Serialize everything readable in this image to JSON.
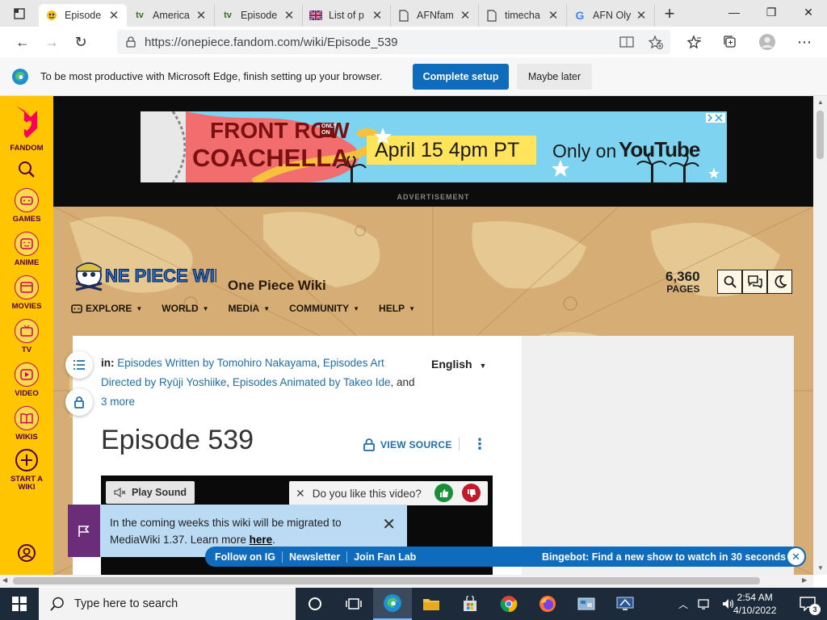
{
  "browser": {
    "tabs": [
      {
        "title": "Episode",
        "icon": "onepiece-favicon",
        "active": true
      },
      {
        "title": "America",
        "icon": "tv-favicon"
      },
      {
        "title": "Episode",
        "icon": "tv-favicon"
      },
      {
        "title": "List of p",
        "icon": "flag-favicon"
      },
      {
        "title": "AFNfam",
        "icon": "page-icon"
      },
      {
        "title": "timecha",
        "icon": "page-icon"
      },
      {
        "title": "AFN Oly",
        "icon": "google-favicon"
      }
    ],
    "new_tab": "+",
    "url": "https://onepiece.fandom.com/wiki/Episode_539"
  },
  "setup_bar": {
    "message": "To be most productive with Microsoft Edge, finish setting up your browser.",
    "complete_label": "Complete setup",
    "later_label": "Maybe later",
    "accent": "#0f6cbd"
  },
  "fandom_rail": {
    "logo_label": "FANDOM",
    "items": [
      {
        "label": "GAMES",
        "icon": "gamepad-icon"
      },
      {
        "label": "ANIME",
        "icon": "anime-face-icon"
      },
      {
        "label": "MOVIES",
        "icon": "film-icon"
      },
      {
        "label": "TV",
        "icon": "tv-icon"
      },
      {
        "label": "VIDEO",
        "icon": "play-icon"
      },
      {
        "label": "WIKIS",
        "icon": "book-icon"
      },
      {
        "label": "START A WIKI",
        "icon": "plus-circle-icon"
      }
    ],
    "color": "#ffc500"
  },
  "ad": {
    "brand": "FRONT ROW",
    "brand2": "COACHELLA",
    "date_text": "April 15 4pm PT",
    "only_on": "Only on",
    "platform": "YouTube",
    "only_on_small": "ONLY ON",
    "label": "ADVERTISEMENT"
  },
  "wiki": {
    "logo_text": "ONE PIECE WIKI",
    "name": "One Piece Wiki",
    "pages_count": "6,360",
    "pages_label": "PAGES",
    "nav": [
      {
        "label": "EXPLORE"
      },
      {
        "label": "WORLD"
      },
      {
        "label": "MEDIA"
      },
      {
        "label": "COMMUNITY"
      },
      {
        "label": "HELP"
      }
    ]
  },
  "article": {
    "categories_prefix": "in:",
    "cat1": "Episodes Written by Tomohiro Nakayama",
    "cat2": "Episodes Art Directed by Ryūji Yoshiike",
    "cat3": "Episodes Animated by Takeo Ide",
    "more_prefix": "and",
    "more_link": "3 more",
    "language": "English",
    "title": "Episode 539",
    "view_source": "VIEW SOURCE"
  },
  "video": {
    "play_sound": "Play Sound",
    "like_question": "Do you like this video?"
  },
  "migrate_toast": {
    "text": "In the coming weeks this wiki will be migrated to MediaWiki 1.37. Learn more",
    "link": "here"
  },
  "fan_bar": {
    "items": [
      "Follow on IG",
      "Newsletter",
      "Join Fan Lab"
    ],
    "bingebot": "Bingebot: Find a new show to watch in 30 seconds"
  },
  "taskbar": {
    "search_placeholder": "Type here to search",
    "time": "2:54 AM",
    "date": "4/10/2022",
    "notification_count": "3"
  }
}
